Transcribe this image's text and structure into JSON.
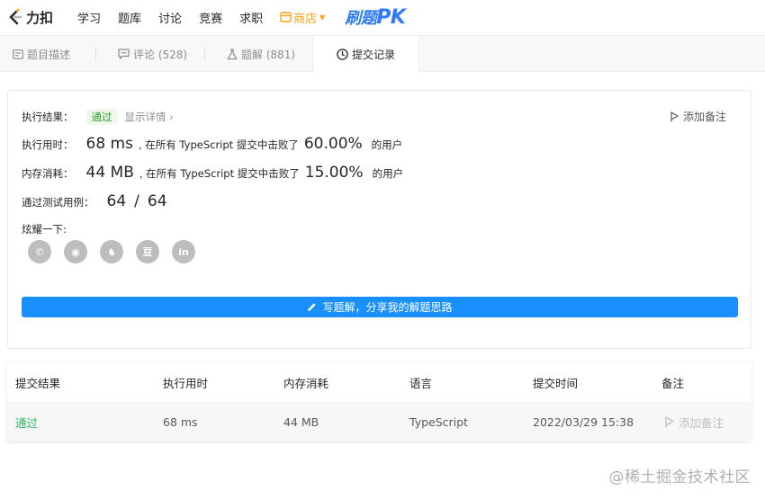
{
  "topnav": {
    "logo_text": "力扣",
    "items": [
      "学习",
      "题库",
      "讨论",
      "竞赛",
      "求职"
    ],
    "shop_label": "商店",
    "pk_label": "刷题",
    "pk_suffix": "PK"
  },
  "tabs": [
    {
      "label": "题目描述",
      "icon": "description-icon"
    },
    {
      "label": "评论 (528)",
      "icon": "comment-icon"
    },
    {
      "label": "题解 (881)",
      "icon": "flask-icon"
    },
    {
      "label": "提交记录",
      "icon": "clock-icon",
      "active": true
    }
  ],
  "result": {
    "status_label": "执行结果：",
    "status_value": "通过",
    "detail_link": "显示详情 ›",
    "add_note": "添加备注",
    "time_label": "执行用时：",
    "time_value": "68 ms",
    "time_mid": ", 在所有 TypeScript 提交中击败了",
    "time_pct": "60.00%",
    "time_tail": "的用户",
    "mem_label": "内存消耗：",
    "mem_value": "44 MB",
    "mem_mid": ", 在所有 TypeScript 提交中击败了",
    "mem_pct": "15.00%",
    "mem_tail": "的用户",
    "tests_label": "通过测试用例：",
    "tests_passed": "64",
    "tests_sep": "/",
    "tests_total": "64",
    "share_label": "炫耀一下:",
    "share_icons": [
      "wechat-icon",
      "weibo-icon",
      "qq-icon",
      "douban-icon",
      "linkedin-icon"
    ],
    "share_glyphs": [
      "✆",
      "◉",
      "♞",
      "豆",
      "in"
    ],
    "solution_button": "写题解，分享我的解题思路"
  },
  "table": {
    "headers": [
      "提交结果",
      "执行用时",
      "内存消耗",
      "语言",
      "提交时间",
      "备注"
    ],
    "rows": [
      {
        "status": "通过",
        "time": "68 ms",
        "memory": "44 MB",
        "language": "TypeScript",
        "submitted": "2022/03/29 15:38",
        "note": "添加备注"
      }
    ]
  },
  "watermark": "@稀土掘金技术社区",
  "colors": {
    "accent": "#ffa116",
    "button": "#1a90ff",
    "success": "#2db55d"
  }
}
